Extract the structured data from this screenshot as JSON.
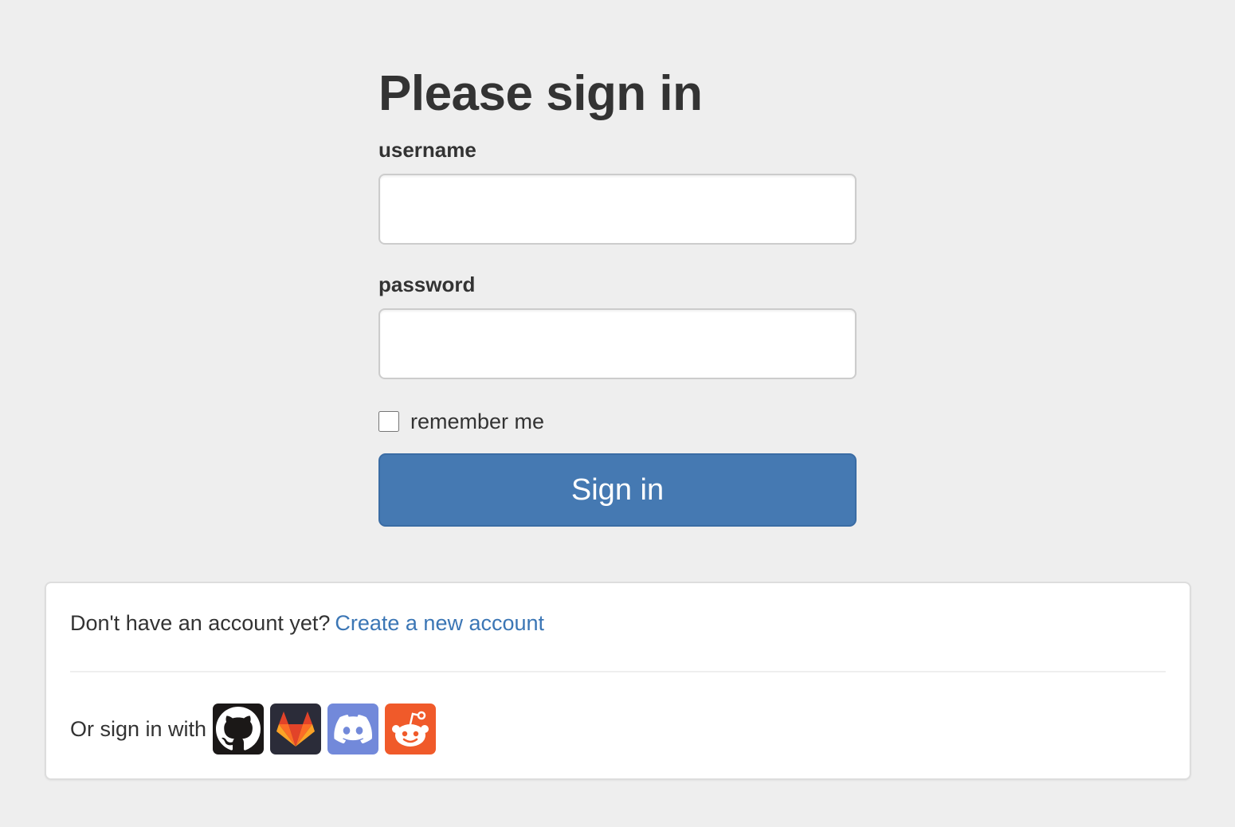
{
  "form": {
    "heading": "Please sign in",
    "username_label": "username",
    "username_value": "",
    "password_label": "password",
    "password_value": "",
    "remember_label": "remember me",
    "remember_checked": false,
    "submit_label": "Sign in"
  },
  "register": {
    "prompt": "Don't have an account yet?",
    "link_text": "Create a new account"
  },
  "oauth": {
    "label": "Or sign in with",
    "providers": [
      {
        "name": "GitHub",
        "icon": "github-icon",
        "color": "#1b1817"
      },
      {
        "name": "GitLab",
        "icon": "gitlab-icon",
        "color": "#2b2c39"
      },
      {
        "name": "Discord",
        "icon": "discord-icon",
        "color": "#7289da"
      },
      {
        "name": "Reddit",
        "icon": "reddit-icon",
        "color": "#f05a2a"
      }
    ]
  },
  "colors": {
    "page_background": "#eeeeee",
    "primary_button": "#4579b2",
    "link": "#3b76b5",
    "text": "#333333"
  }
}
